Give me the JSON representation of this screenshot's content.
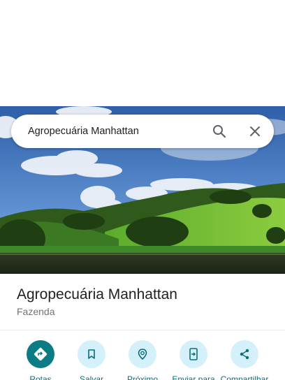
{
  "search": {
    "query": "Agropecuária Manhattan"
  },
  "place": {
    "title": "Agropecuária Manhattan",
    "category": "Fazenda"
  },
  "actions": [
    {
      "label": "Rotas",
      "icon": "directions-icon"
    },
    {
      "label": "Salvar",
      "icon": "bookmark-icon"
    },
    {
      "label": "Próximo",
      "icon": "nearby-icon"
    },
    {
      "label": "Enviar para",
      "icon": "send-to-device-icon"
    },
    {
      "label": "Compartilhar",
      "icon": "share-icon"
    }
  ],
  "colors": {
    "primary": "#0b7c86",
    "action_circle": "#d4f0fb",
    "title": "#202124",
    "subtitle": "#70757a"
  }
}
